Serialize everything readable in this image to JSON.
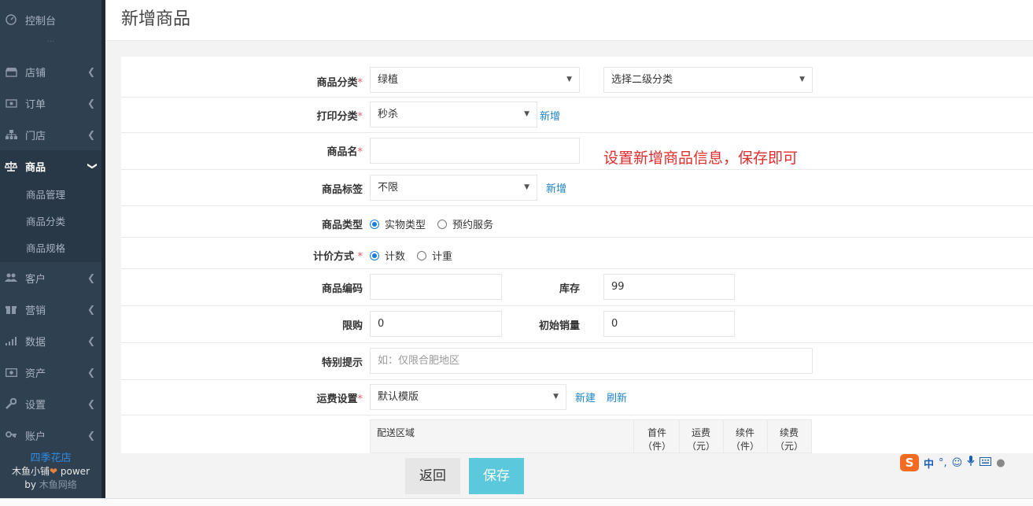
{
  "sidebar": {
    "dashboard": "控制台",
    "dots": "···",
    "items": [
      {
        "label": "店铺",
        "icon": "store-icon"
      },
      {
        "label": "订单",
        "icon": "orders-icon"
      },
      {
        "label": "门店",
        "icon": "branch-icon"
      },
      {
        "label": "商品",
        "icon": "scale-icon"
      },
      {
        "label": "客户",
        "icon": "users-icon"
      },
      {
        "label": "营销",
        "icon": "gift-icon"
      },
      {
        "label": "数据",
        "icon": "chart-icon"
      },
      {
        "label": "资产",
        "icon": "money-icon"
      },
      {
        "label": "设置",
        "icon": "wrench-icon"
      },
      {
        "label": "账户",
        "icon": "key-icon"
      }
    ],
    "submenu": [
      "商品管理",
      "商品分类",
      "商品规格"
    ],
    "brand": {
      "shop": "四季花店",
      "line1": "木鱼小铺",
      "line1b": "power",
      "line2a": "by",
      "line2b": "木鱼网络"
    }
  },
  "page": {
    "title": "新增商品"
  },
  "form": {
    "category_label": "商品分类",
    "category_value": "绿植",
    "subcategory_value": "选择二级分类",
    "print_label": "打印分类",
    "print_value": "秒杀",
    "print_add": "新增",
    "name_label": "商品名",
    "name_value": "",
    "hint": "设置新增商品信息，保存即可",
    "tag_label": "商品标签",
    "tag_value": "不限",
    "tag_add": "新增",
    "type_label": "商品类型",
    "type_opt1": "实物类型",
    "type_opt2": "预约服务",
    "pricing_label": "计价方式",
    "pricing_opt1": "计数",
    "pricing_opt2": "计重",
    "code_label": "商品编码",
    "code_value": "",
    "stock_label": "库存",
    "stock_value": "99",
    "limit_label": "限购",
    "limit_value": "0",
    "initial_sales_label": "初始销量",
    "initial_sales_value": "0",
    "notice_label": "特别提示",
    "notice_placeholder": "如：仅限合肥地区",
    "shipping_label": "运费设置",
    "shipping_value": "默认模版",
    "shipping_new": "新建",
    "shipping_refresh": "刷新",
    "table_headers": [
      "配送区域",
      "首件（件）",
      "运费（元）",
      "续件（件）",
      "续费（元）"
    ],
    "th": {
      "area": "配送区域",
      "first_a": "首件",
      "first_b": "（件）",
      "fee_a": "运费",
      "fee_b": "（元）",
      "cont_a": "续件",
      "cont_b": "（件）",
      "renew_a": "续费",
      "renew_b": "（元）"
    }
  },
  "buttons": {
    "back": "返回",
    "save": "保存"
  },
  "ime": {
    "logo": "S",
    "lang": "中",
    "punct": "°,"
  },
  "colors": {
    "sidebar": "#2f4050",
    "accent": "#1c84c6",
    "save": "#5bc8dc",
    "hint": "#e02d2d"
  }
}
